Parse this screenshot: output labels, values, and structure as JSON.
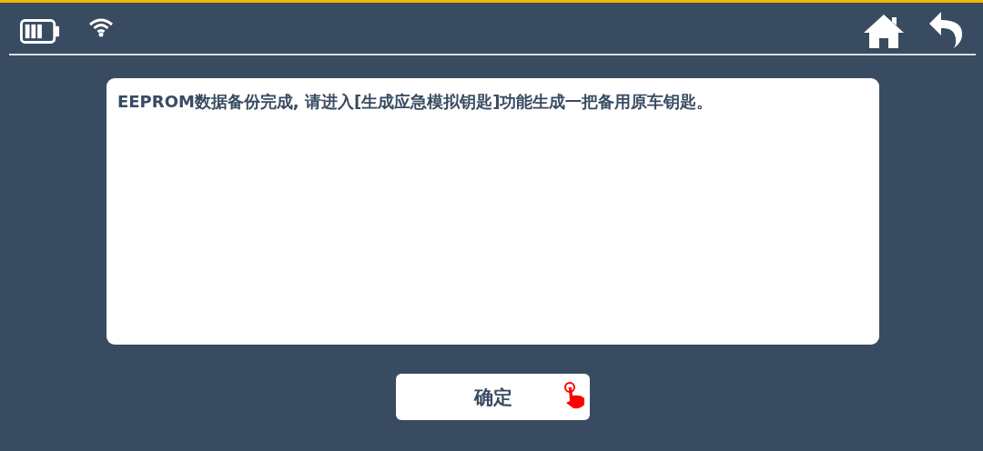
{
  "message": "EEPROM数据备份完成, 请进入[生成应急模拟钥匙]功能生成一把备用原车钥匙。",
  "button": {
    "label": "确定"
  }
}
